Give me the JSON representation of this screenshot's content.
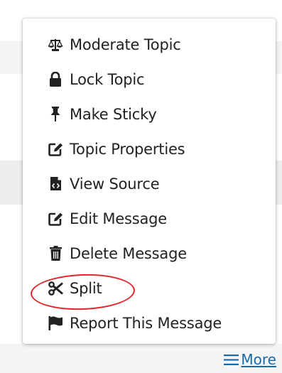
{
  "menu": {
    "items": [
      {
        "label": "Moderate Topic",
        "icon": "scales-icon"
      },
      {
        "label": "Lock Topic",
        "icon": "lock-icon"
      },
      {
        "label": "Make Sticky",
        "icon": "pin-icon"
      },
      {
        "label": "Topic Properties",
        "icon": "edit-icon"
      },
      {
        "label": "View Source",
        "icon": "code-file-icon"
      },
      {
        "label": "Edit Message",
        "icon": "edit-icon"
      },
      {
        "label": "Delete Message",
        "icon": "trash-icon"
      },
      {
        "label": "Split",
        "icon": "scissors-icon"
      },
      {
        "label": "Report This Message",
        "icon": "flag-icon"
      }
    ]
  },
  "more_link": {
    "label": "More",
    "icon": "hamburger-icon"
  },
  "colors": {
    "highlight": "#e3242b",
    "link": "#1a6aa8",
    "text": "#222222"
  }
}
